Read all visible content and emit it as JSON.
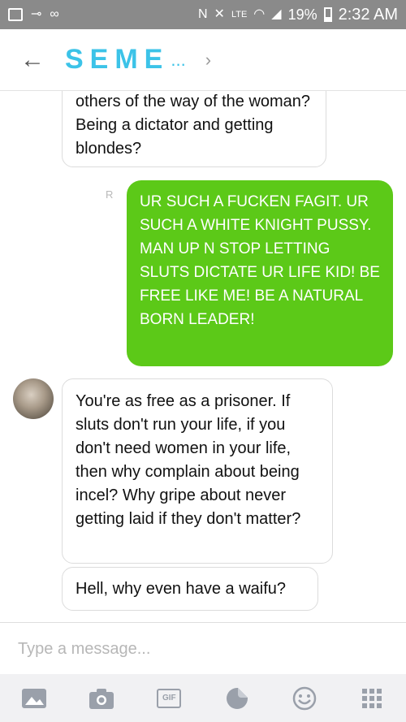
{
  "status_bar": {
    "battery_percent": "19%",
    "time": "2:32 AM",
    "network": "LTE"
  },
  "header": {
    "back_icon": "arrow-left-icon",
    "title": "SEME",
    "title_ellipsis": "...",
    "chevron_icon": "chevron-right-icon"
  },
  "messages": [
    {
      "direction": "incoming",
      "text": "others of the way of the woman? Being a dictator and getting blondes?"
    },
    {
      "direction": "outgoing",
      "read_mark": "R",
      "text": "UR SUCH A FUCKEN FAGIT. UR SUCH A WHITE KNIGHT PUSSY. MAN UP N STOP LETTING SLUTS DICTATE UR LIFE KID! BE FREE LIKE ME! BE A NATURAL BORN LEADER!"
    },
    {
      "direction": "incoming",
      "text": "You're as free as a prisoner. If sluts don't run your life, if you don't need women in your life, then why complain about being incel? Why gripe about never getting laid if they don't matter?"
    },
    {
      "direction": "incoming",
      "text": "Hell, why even have a waifu?"
    }
  ],
  "composer": {
    "placeholder": "Type a message..."
  },
  "toolbar": {
    "gif_label": "GIF",
    "icons": [
      "image-icon",
      "camera-icon",
      "gif-icon",
      "sticker-icon",
      "emoji-icon",
      "apps-grid-icon"
    ]
  },
  "colors": {
    "status_bar": "#8a8a8a",
    "brand": "#3cc3e8",
    "outgoing_bubble": "#5cc918",
    "toolbar_bg": "#f1f1f3"
  }
}
